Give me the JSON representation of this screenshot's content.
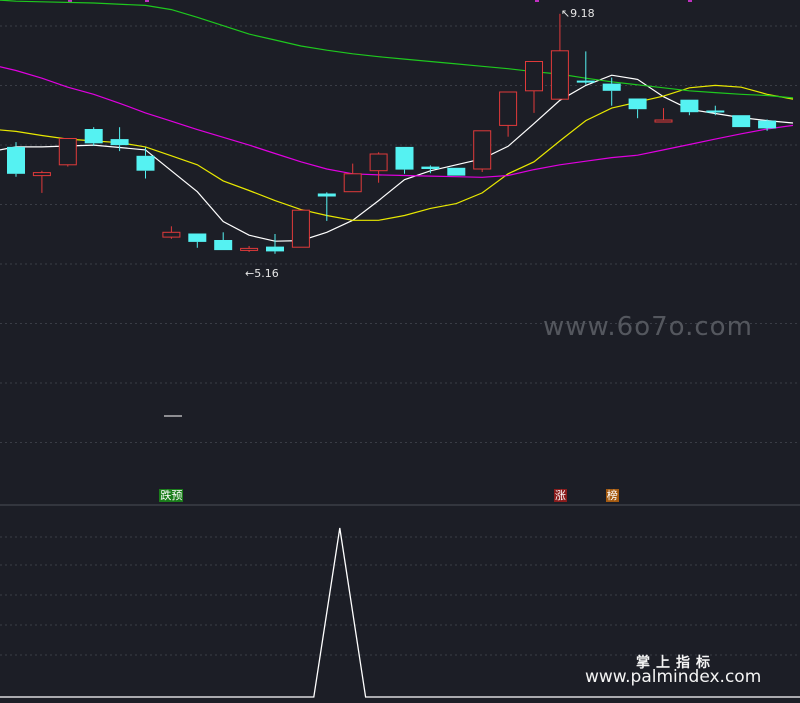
{
  "chart_data": [
    {
      "type": "candlestick",
      "panel": "main",
      "grid": true,
      "ylim": [
        4.6,
        9.4
      ],
      "candles": [
        {
          "open": 6.5,
          "close": 6.95,
          "high": 7.03,
          "low": 6.45,
          "dir": "down"
        },
        {
          "open": 6.52,
          "close": 6.47,
          "high": 6.55,
          "low": 6.18,
          "dir": "up"
        },
        {
          "open": 6.65,
          "close": 7.09,
          "high": 7.09,
          "low": 6.62,
          "dir": "up"
        },
        {
          "open": 7.01,
          "close": 7.25,
          "high": 7.28,
          "low": 6.97,
          "dir": "down"
        },
        {
          "open": 6.98,
          "close": 7.08,
          "high": 7.28,
          "low": 6.88,
          "dir": "down"
        },
        {
          "open": 6.55,
          "close": 6.8,
          "high": 6.94,
          "low": 6.42,
          "dir": "down"
        },
        {
          "open": 5.44,
          "close": 5.52,
          "high": 5.62,
          "low": 5.41,
          "dir": "up"
        },
        {
          "open": 5.36,
          "close": 5.5,
          "high": 5.5,
          "low": 5.26,
          "dir": "down"
        },
        {
          "open": 5.22,
          "close": 5.39,
          "high": 5.52,
          "low": 5.22,
          "dir": "down"
        },
        {
          "open": 5.23,
          "close": 5.25,
          "high": 5.29,
          "low": 5.19,
          "dir": "up"
        },
        {
          "open": 5.2,
          "close": 5.28,
          "high": 5.49,
          "low": 5.16,
          "dir": "down"
        },
        {
          "open": 5.27,
          "close": 5.89,
          "high": 5.89,
          "low": 5.27,
          "dir": "up"
        },
        {
          "open": 6.12,
          "close": 6.17,
          "high": 6.19,
          "low": 5.71,
          "dir": "down"
        },
        {
          "open": 6.2,
          "close": 6.5,
          "high": 6.67,
          "low": 6.2,
          "dir": "up"
        },
        {
          "open": 6.55,
          "close": 6.83,
          "high": 6.86,
          "low": 6.35,
          "dir": "up"
        },
        {
          "open": 6.57,
          "close": 6.95,
          "high": 6.95,
          "low": 6.5,
          "dir": "down"
        },
        {
          "open": 6.58,
          "close": 6.62,
          "high": 6.64,
          "low": 6.51,
          "dir": "down"
        },
        {
          "open": 6.47,
          "close": 6.6,
          "high": 6.6,
          "low": 6.47,
          "dir": "down"
        },
        {
          "open": 6.58,
          "close": 7.22,
          "high": 7.22,
          "low": 6.53,
          "dir": "up"
        },
        {
          "open": 7.31,
          "close": 7.87,
          "high": 7.87,
          "low": 7.12,
          "dir": "up"
        },
        {
          "open": 7.89,
          "close": 8.38,
          "high": 8.38,
          "low": 7.52,
          "dir": "up"
        },
        {
          "open": 7.75,
          "close": 8.56,
          "high": 9.18,
          "low": 7.75,
          "dir": "up"
        },
        {
          "open": 8.06,
          "close": 8.03,
          "high": 8.55,
          "low": 7.99,
          "dir": "down"
        },
        {
          "open": 8.01,
          "close": 7.89,
          "high": 8.11,
          "low": 7.64,
          "dir": "down"
        },
        {
          "open": 7.76,
          "close": 7.58,
          "high": 7.76,
          "low": 7.43,
          "dir": "down"
        },
        {
          "open": 7.4,
          "close": 7.38,
          "high": 7.6,
          "low": 7.36,
          "dir": "up"
        },
        {
          "open": 7.74,
          "close": 7.53,
          "high": 7.74,
          "low": 7.48,
          "dir": "down"
        },
        {
          "open": 7.56,
          "close": 7.53,
          "high": 7.64,
          "low": 7.48,
          "dir": "down"
        },
        {
          "open": 7.48,
          "close": 7.28,
          "high": 7.48,
          "low": 7.28,
          "dir": "down"
        },
        {
          "open": 7.39,
          "close": 7.26,
          "high": 7.41,
          "low": 7.22,
          "dir": "down"
        }
      ],
      "moving_averages": [
        {
          "color": "#ffffff",
          "points": [
            [
              -1,
              6.87
            ],
            [
              0,
              6.95
            ],
            [
              1,
              6.95
            ],
            [
              3,
              6.98
            ],
            [
              5,
              6.9
            ],
            [
              7,
              6.2
            ],
            [
              8,
              5.7
            ],
            [
              9,
              5.47
            ],
            [
              10,
              5.37
            ],
            [
              11,
              5.38
            ],
            [
              12,
              5.52
            ],
            [
              13,
              5.72
            ],
            [
              14,
              6.05
            ],
            [
              15,
              6.4
            ],
            [
              16,
              6.55
            ],
            [
              17,
              6.65
            ],
            [
              18,
              6.75
            ],
            [
              19,
              6.96
            ],
            [
              20,
              7.34
            ],
            [
              21,
              7.73
            ],
            [
              22,
              7.98
            ],
            [
              23,
              8.15
            ],
            [
              24,
              8.08
            ],
            [
              25,
              7.79
            ],
            [
              26,
              7.58
            ],
            [
              27,
              7.51
            ],
            [
              28,
              7.44
            ],
            [
              29,
              7.39
            ],
            [
              30,
              7.35
            ]
          ]
        },
        {
          "color": "#e8e800",
          "points": [
            [
              -1,
              7.25
            ],
            [
              0,
              7.21
            ],
            [
              1,
              7.14
            ],
            [
              2,
              7.08
            ],
            [
              3,
              7.05
            ],
            [
              4,
              7.02
            ],
            [
              5,
              6.95
            ],
            [
              6,
              6.8
            ],
            [
              7,
              6.65
            ],
            [
              8,
              6.38
            ],
            [
              9,
              6.22
            ],
            [
              10,
              6.05
            ],
            [
              11,
              5.9
            ],
            [
              12,
              5.8
            ],
            [
              13,
              5.72
            ],
            [
              14,
              5.72
            ],
            [
              15,
              5.8
            ],
            [
              16,
              5.92
            ],
            [
              17,
              6.0
            ],
            [
              18,
              6.18
            ],
            [
              19,
              6.5
            ],
            [
              20,
              6.7
            ],
            [
              21,
              7.05
            ],
            [
              22,
              7.39
            ],
            [
              23,
              7.6
            ],
            [
              24,
              7.7
            ],
            [
              25,
              7.8
            ],
            [
              26,
              7.94
            ],
            [
              27,
              7.98
            ],
            [
              28,
              7.95
            ],
            [
              29,
              7.83
            ],
            [
              30,
              7.75
            ]
          ]
        },
        {
          "color": "#e000e0",
          "points": [
            [
              -1,
              8.33
            ],
            [
              0,
              8.23
            ],
            [
              1,
              8.1
            ],
            [
              2,
              7.95
            ],
            [
              3,
              7.83
            ],
            [
              4,
              7.68
            ],
            [
              5,
              7.52
            ],
            [
              6,
              7.38
            ],
            [
              7,
              7.24
            ],
            [
              8,
              7.11
            ],
            [
              9,
              6.98
            ],
            [
              10,
              6.84
            ],
            [
              11,
              6.7
            ],
            [
              12,
              6.58
            ],
            [
              13,
              6.5
            ],
            [
              14,
              6.48
            ],
            [
              15,
              6.47
            ],
            [
              16,
              6.46
            ],
            [
              17,
              6.45
            ],
            [
              18,
              6.44
            ],
            [
              19,
              6.47
            ],
            [
              20,
              6.57
            ],
            [
              21,
              6.65
            ],
            [
              22,
              6.71
            ],
            [
              23,
              6.77
            ],
            [
              24,
              6.81
            ],
            [
              25,
              6.9
            ],
            [
              26,
              6.99
            ],
            [
              27,
              7.08
            ],
            [
              28,
              7.17
            ],
            [
              29,
              7.25
            ],
            [
              30,
              7.31
            ]
          ]
        },
        {
          "color": "#1ec81e",
          "points": [
            [
              -1,
              9.42
            ],
            [
              0,
              9.39
            ],
            [
              1,
              9.38
            ],
            [
              3,
              9.36
            ],
            [
              5,
              9.32
            ],
            [
              6,
              9.25
            ],
            [
              7,
              9.12
            ],
            [
              8,
              8.98
            ],
            [
              9,
              8.84
            ],
            [
              10,
              8.74
            ],
            [
              11,
              8.64
            ],
            [
              12,
              8.57
            ],
            [
              13,
              8.51
            ],
            [
              14,
              8.46
            ],
            [
              15,
              8.42
            ],
            [
              16,
              8.38
            ],
            [
              17,
              8.34
            ],
            [
              18,
              8.3
            ],
            [
              19,
              8.26
            ],
            [
              20,
              8.21
            ],
            [
              21,
              8.17
            ],
            [
              22,
              8.1
            ],
            [
              23,
              8.04
            ],
            [
              24,
              7.99
            ],
            [
              25,
              7.94
            ],
            [
              26,
              7.89
            ],
            [
              27,
              7.86
            ],
            [
              28,
              7.83
            ],
            [
              29,
              7.81
            ],
            [
              30,
              7.77
            ]
          ]
        }
      ],
      "annotations": [
        {
          "text": "9.18",
          "candle": 21,
          "price": 9.18,
          "color": "#e6e6e6"
        },
        {
          "text": "5.16",
          "candle": 10,
          "price": 5.16,
          "color": "#e6e6e6"
        }
      ],
      "markers": [
        {
          "text": "跌预",
          "candle": 6,
          "text_color": "#ffffff",
          "bg_color": "#1b7d1b"
        },
        {
          "text": "涨",
          "candle": 21,
          "text_color": "#ffffff",
          "bg_color": "#8a1c1c"
        },
        {
          "text": "榜",
          "candle": 23,
          "text_color": "#ffffff",
          "bg_color": "#a45a10"
        }
      ]
    },
    {
      "type": "line",
      "panel": "indicator",
      "color": "#ffffff",
      "grid": true,
      "ylim": [
        0,
        1
      ],
      "points": [
        [
          -1,
          0
        ],
        [
          11.5,
          0
        ],
        [
          12.5,
          1
        ],
        [
          13.5,
          0
        ],
        [
          31,
          0
        ]
      ]
    }
  ],
  "colors": {
    "background": "#1c1e26",
    "grid": "#3a3d46",
    "up": "#e03a3a",
    "down": "#55f2f2",
    "top_marks": "#c030c0"
  },
  "watermarks": {
    "site": "www.6o7o.com",
    "brand_cn": "掌上指标",
    "brand_url": "www.palmindex.com"
  }
}
